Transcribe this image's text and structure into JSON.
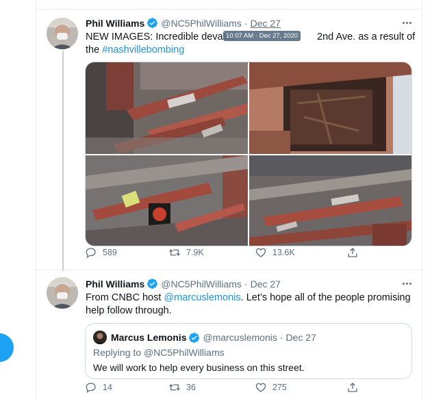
{
  "tweet1": {
    "name": "Phil Williams",
    "handle": "@NC5PhilWilliams",
    "separator": "·",
    "date": "Dec 27",
    "tooltip": "10:07 AM · Dec 27, 2020",
    "text_before": "NEW IMAGES: Incredible devasta",
    "text_after": " 2nd Ave. as a result of",
    "text_line2_prefix": "the ",
    "hashtag": "#nashvillebombing",
    "replies": "589",
    "retweets": "7.9K",
    "likes": "13.6K"
  },
  "tweet2": {
    "name": "Phil Williams",
    "handle": "@NC5PhilWilliams",
    "separator": "·",
    "date": "Dec 27",
    "text_prefix": "From CNBC host ",
    "mention": "@marcuslemonis",
    "text_suffix": ". Let’s hope all of the people promising",
    "text_line2": "help follow through.",
    "replies": "14",
    "retweets": "36",
    "likes": "275"
  },
  "quote": {
    "name": "Marcus Lemonis",
    "handle": "@marcuslemonis",
    "separator": "·",
    "date": "Dec 27",
    "replying_label": "Replying to ",
    "replying_handle": "@NC5PhilWilliams",
    "text": "We will work to help every business on this street."
  },
  "colors": {
    "accent": "#1da1f2",
    "link": "#1b95e0",
    "secondary_text": "#5b7083"
  },
  "icons": {
    "verified": "verified-badge-icon",
    "more": "more-options-icon",
    "reply": "reply-icon",
    "retweet": "retweet-icon",
    "like": "heart-icon",
    "share": "share-icon"
  }
}
